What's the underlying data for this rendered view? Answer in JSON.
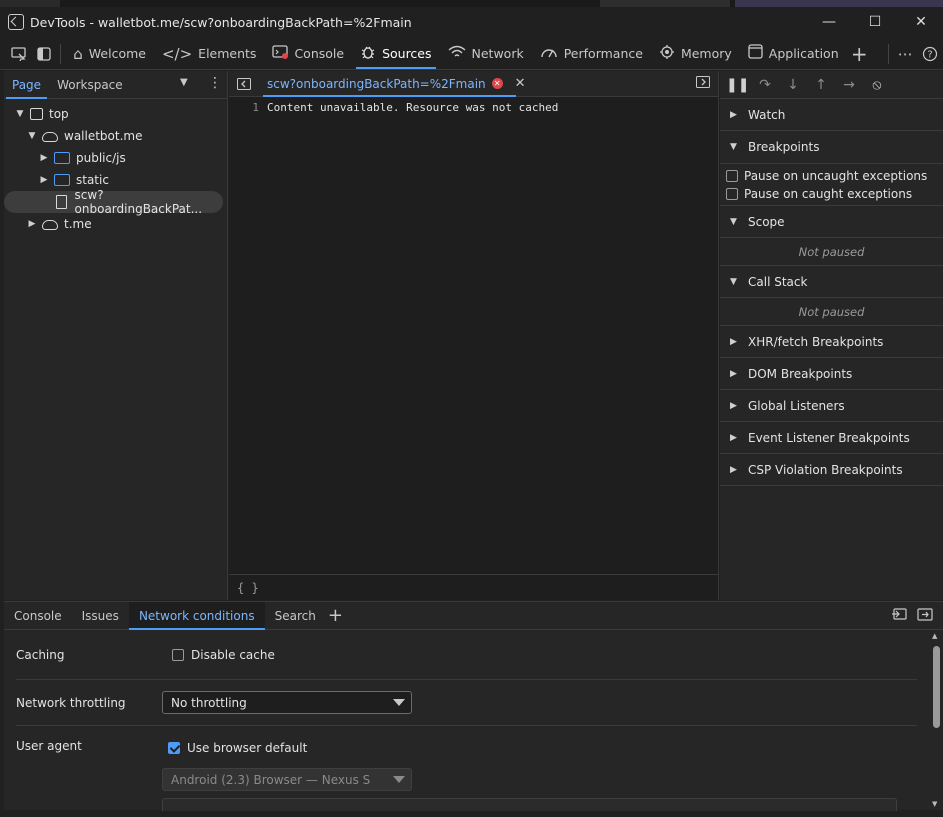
{
  "window": {
    "title": "DevTools - walletbot.me/scw?onboardingBackPath=%2Fmain",
    "controls": {
      "minimize": "—",
      "maximize": "☐",
      "close": "✕"
    }
  },
  "main_tabs": [
    {
      "label": "Welcome",
      "icon": "home-icon"
    },
    {
      "label": "Elements",
      "icon": "code-icon"
    },
    {
      "label": "Console",
      "icon": "console-icon"
    },
    {
      "label": "Sources",
      "icon": "bug-icon",
      "active": true
    },
    {
      "label": "Network",
      "icon": "wifi-icon"
    },
    {
      "label": "Performance",
      "icon": "gauge-icon"
    },
    {
      "label": "Memory",
      "icon": "chip-icon"
    },
    {
      "label": "Application",
      "icon": "app-icon"
    }
  ],
  "left_panel": {
    "tabs": [
      "Page",
      "Workspace"
    ],
    "tree": [
      {
        "label": "top"
      },
      {
        "label": "walletbot.me"
      },
      {
        "label": "public/js"
      },
      {
        "label": "static"
      },
      {
        "label": "scw?onboardingBackPat..."
      },
      {
        "label": "t.me"
      }
    ]
  },
  "editor": {
    "tab_label": "scw?onboardingBackPath=%2Fmain",
    "line_number": "1",
    "line_text": "Content unavailable. Resource was not cached",
    "footer": "{ }"
  },
  "debugger": {
    "watch": "Watch",
    "breakpoints": "Breakpoints",
    "pause_uncaught": "Pause on uncaught exceptions",
    "pause_caught": "Pause on caught exceptions",
    "scope": "Scope",
    "scope_status": "Not paused",
    "call_stack": "Call Stack",
    "call_stack_status": "Not paused",
    "xhr": "XHR/fetch Breakpoints",
    "dom": "DOM Breakpoints",
    "global": "Global Listeners",
    "event": "Event Listener Breakpoints",
    "csp": "CSP Violation Breakpoints"
  },
  "drawer": {
    "tabs": [
      "Console",
      "Issues",
      "Network conditions",
      "Search"
    ],
    "caching_label": "Caching",
    "disable_cache_label": "Disable cache",
    "throttling_label": "Network throttling",
    "throttling_value": "No throttling",
    "user_agent_label": "User agent",
    "use_browser_default_label": "Use browser default",
    "ua_select_value": "Android (2.3) Browser — Nexus S"
  }
}
